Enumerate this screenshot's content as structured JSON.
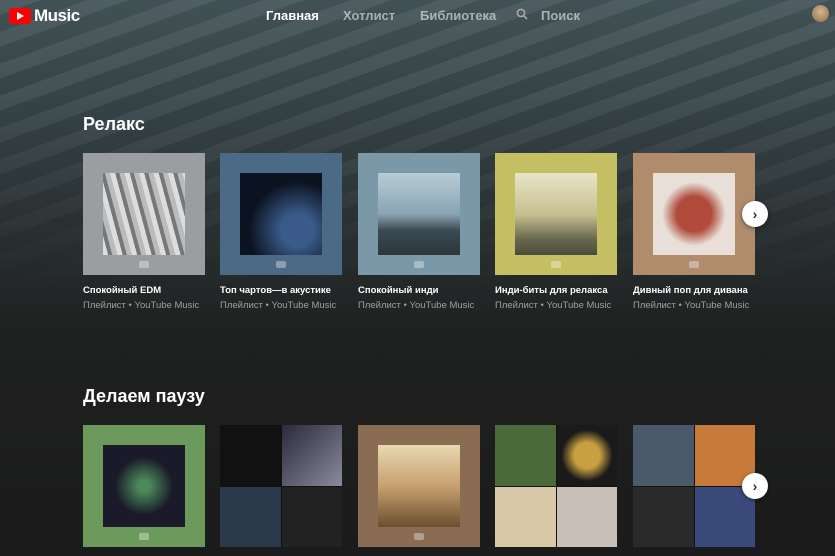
{
  "header": {
    "logo_text": "Music",
    "nav": [
      "Главная",
      "Хотлист",
      "Библиотека"
    ],
    "search_label": "Поиск"
  },
  "sections": [
    {
      "title": "Релакс",
      "cards": [
        {
          "title": "Спокойный EDM",
          "subtitle": "Плейлист • YouTube Music"
        },
        {
          "title": "Топ чартов—в акустике",
          "subtitle": "Плейлист • YouTube Music"
        },
        {
          "title": "Спокойный инди",
          "subtitle": "Плейлист • YouTube Music"
        },
        {
          "title": "Инди-биты для релакса",
          "subtitle": "Плейлист • YouTube Music"
        },
        {
          "title": "Дивный поп для дивана",
          "subtitle": "Плейлист • YouTube Music"
        }
      ]
    },
    {
      "title": "Делаем паузу"
    }
  ],
  "icons": {
    "next": "chevron-right-icon",
    "search": "search-icon"
  }
}
